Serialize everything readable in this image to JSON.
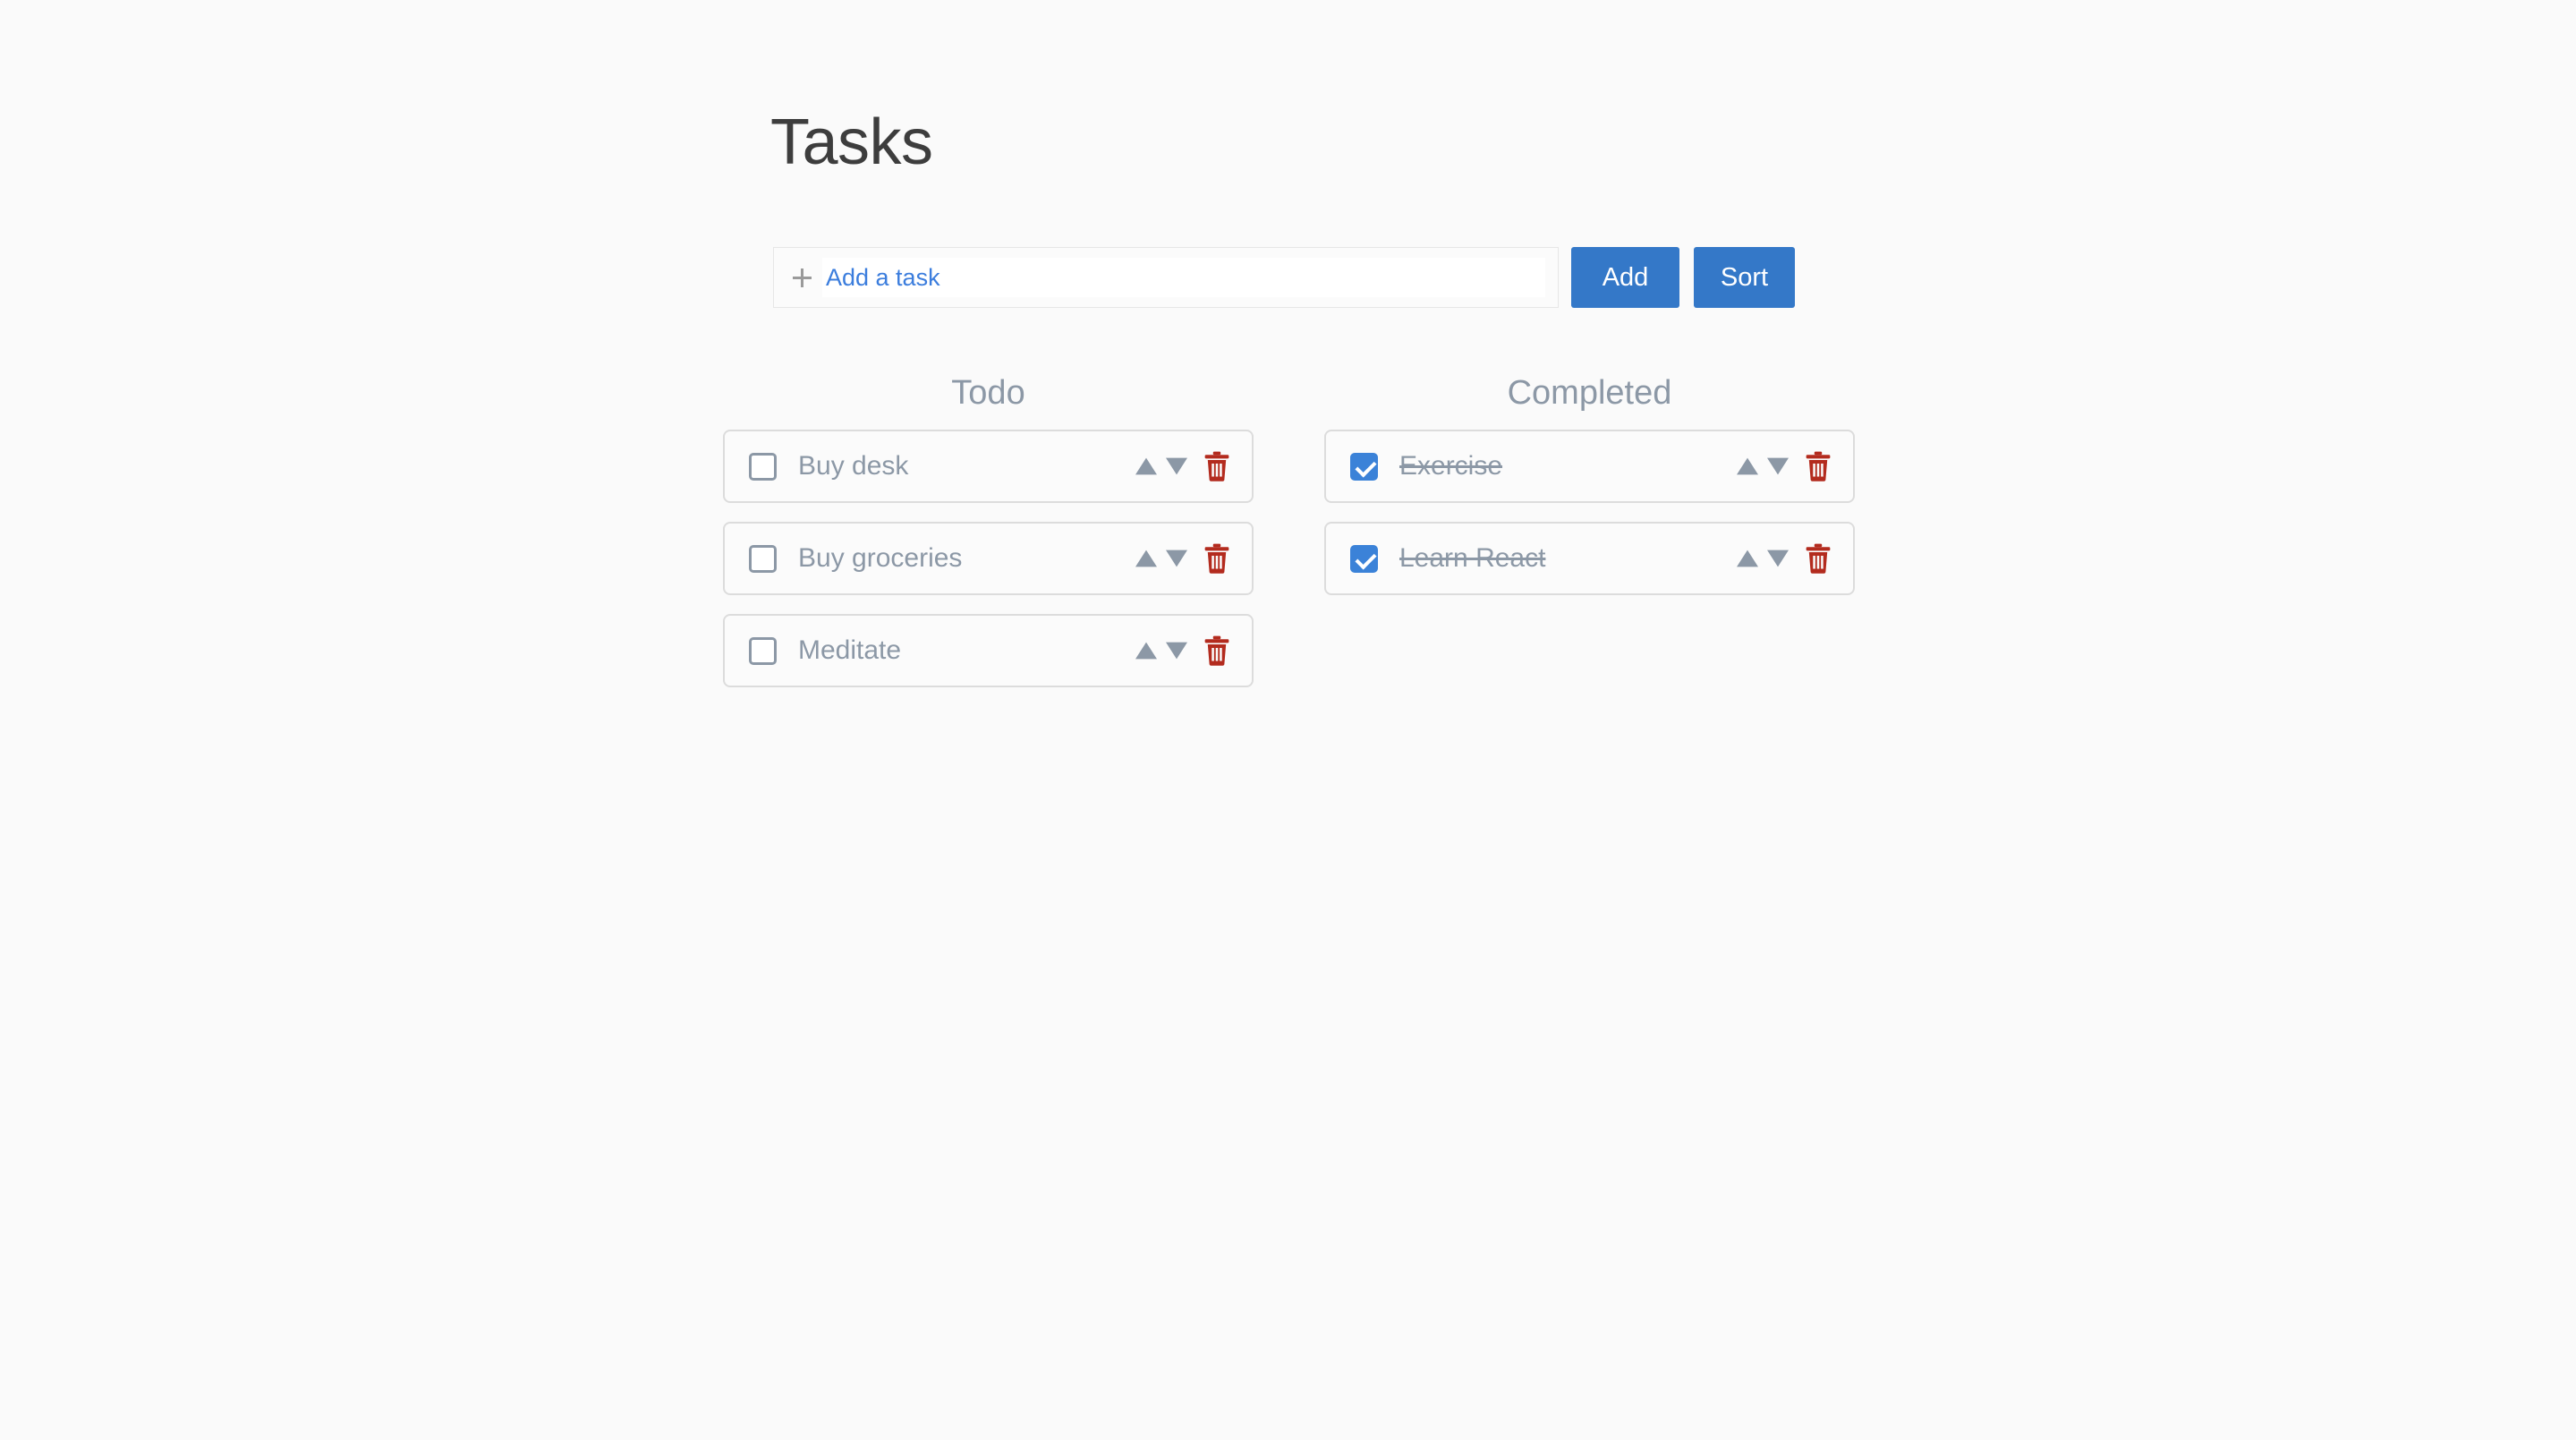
{
  "app": {
    "title": "Tasks",
    "background_color": "#fafafa"
  },
  "add_bar": {
    "input_value": "",
    "input_placeholder": "Add a task",
    "plus_icon": "plus-icon",
    "add_label": "Add",
    "sort_label": "Sort",
    "button_color": "#3478c8",
    "placeholder_color": "#3b7ddd"
  },
  "columns": [
    {
      "id": "todo",
      "header": "Todo",
      "tasks": [
        {
          "label": "Buy desk",
          "completed": false
        },
        {
          "label": "Buy groceries",
          "completed": false
        },
        {
          "label": "Meditate",
          "completed": false
        }
      ]
    },
    {
      "id": "completed",
      "header": "Completed",
      "tasks": [
        {
          "label": "Exercise",
          "completed": true
        },
        {
          "label": "Learn React",
          "completed": true
        }
      ]
    }
  ],
  "row_actions": {
    "move_up": "move-up",
    "move_down": "move-down",
    "delete": "delete",
    "arrow_color": "#8c98a6",
    "trash_color": "#b32b1e"
  },
  "colors": {
    "text_muted": "#8c98a6",
    "title": "#3d3d3d",
    "checkbox_checked": "#3b82d8",
    "card_border": "#dcdcdc"
  }
}
